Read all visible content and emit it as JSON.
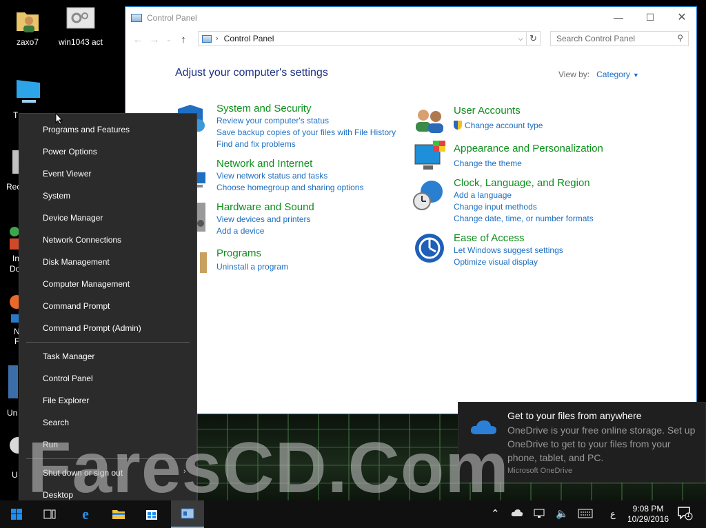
{
  "desktop": {
    "icons": [
      {
        "label": "zaxo7",
        "icon": "folder-user-icon"
      },
      {
        "label": "win1043 act",
        "icon": "settings-file-icon"
      }
    ],
    "partial_labels": [
      "T",
      "Rec",
      "In",
      "Do",
      "N",
      "F",
      "Un",
      "U"
    ]
  },
  "control_panel": {
    "window_title": "Control Panel",
    "address": "Control Panel",
    "search_placeholder": "Search Control Panel",
    "heading": "Adjust your computer's settings",
    "view_by_label": "View by:",
    "view_by_value": "Category",
    "categories": [
      {
        "title": "System and Security",
        "icon": "shield-icon",
        "links": [
          "Review your computer's status",
          "Save backup copies of your files with File History",
          "Find and fix problems"
        ]
      },
      {
        "title": "Network and Internet",
        "icon": "network-icon",
        "links": [
          "View network status and tasks",
          "Choose homegroup and sharing options"
        ]
      },
      {
        "title": "Hardware and Sound",
        "icon": "printer-speaker-icon",
        "links": [
          "View devices and printers",
          "Add a device"
        ]
      },
      {
        "title": "Programs",
        "icon": "programs-icon",
        "links": [
          "Uninstall a program"
        ]
      },
      {
        "title": "User Accounts",
        "icon": "users-icon",
        "links": [
          "Change account type"
        ]
      },
      {
        "title": "Appearance and Personalization",
        "icon": "monitor-palette-icon",
        "links": [
          "Change the theme"
        ]
      },
      {
        "title": "Clock, Language, and Region",
        "icon": "clock-globe-icon",
        "links": [
          "Add a language",
          "Change input methods",
          "Change date, time, or number formats"
        ]
      },
      {
        "title": "Ease of Access",
        "icon": "ease-of-access-icon",
        "links": [
          "Let Windows suggest settings",
          "Optimize visual display"
        ]
      }
    ]
  },
  "context_menu": {
    "group1": [
      "Programs and Features",
      "Power Options",
      "Event Viewer",
      "System",
      "Device Manager",
      "Network Connections",
      "Disk Management",
      "Computer Management",
      "Command Prompt",
      "Command Prompt (Admin)"
    ],
    "group2": [
      "Task Manager",
      "Control Panel",
      "File Explorer",
      "Search",
      "Run"
    ],
    "group3": [
      "Shut down or sign out",
      "Desktop"
    ]
  },
  "notification": {
    "title": "Get to your files from anywhere",
    "body": "OneDrive is your free online storage. Set up OneDrive to get to your files from your phone, tablet, and PC.",
    "source": "Microsoft OneDrive"
  },
  "watermark": "FaresCD.Com",
  "taskbar": {
    "time": "9:08 PM",
    "date": "10/29/2016",
    "language": "ع",
    "notification_count": "1"
  },
  "colors": {
    "accent": "#1e6fc1",
    "category_green": "#0d8f1c",
    "heading_blue": "#1e3287",
    "menu_bg": "#2b2b2b",
    "taskbar_bg": "#101010"
  }
}
